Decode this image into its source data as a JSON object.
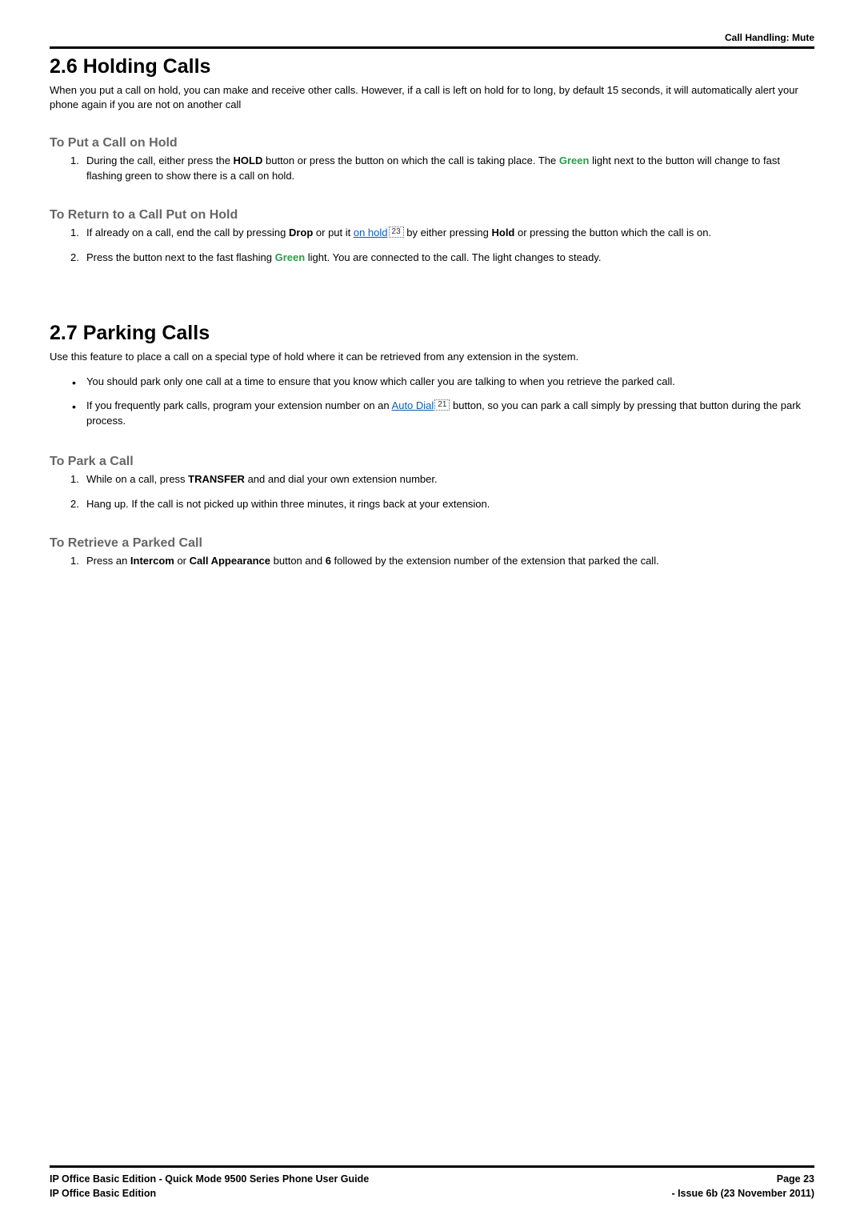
{
  "header": {
    "breadcrumb": "Call Handling: Mute"
  },
  "section_26": {
    "title": "2.6 Holding Calls",
    "intro": "When you put a call on hold, you can make and receive other calls. However, if a call is left on hold for to long, by default 15 seconds, it will automatically alert your phone again if you are not on another call",
    "put_on_hold": {
      "heading": "To Put a Call on Hold",
      "item1_prefix": "During the call, either press the ",
      "item1_hold": "HOLD",
      "item1_mid": " button or press the button on which the call is taking place. The ",
      "item1_green": "Green",
      "item1_suffix": " light next to the button will change to fast flashing green to show there is a call on hold."
    },
    "return_hold": {
      "heading": "To Return to a Call Put on Hold",
      "item1_prefix": "If already on a call, end the call by pressing ",
      "item1_drop": "Drop",
      "item1_mid1": " or put it ",
      "item1_link": "on hold",
      "item1_ref": "23",
      "item1_mid2": " by either pressing ",
      "item1_hold": "Hold",
      "item1_suffix": " or pressing the button which the call is on.",
      "item2_prefix": "Press the button next to the fast flashing ",
      "item2_green": "Green",
      "item2_suffix": " light. You are connected to the call. The light changes to steady."
    }
  },
  "section_27": {
    "title": "2.7 Parking Calls",
    "intro": "Use this feature to place a call on a special type of hold where it can be retrieved from any extension in the system.",
    "bullet1": "You should park only one call at a time to ensure that you know which caller you are talking to when you retrieve the parked call.",
    "bullet2_prefix": "If you frequently park calls, program your extension number on an ",
    "bullet2_link": "Auto Dial",
    "bullet2_ref": "21",
    "bullet2_suffix": " button, so you can park a call simply by pressing that button during the park process.",
    "park_call": {
      "heading": "To Park a Call",
      "item1_prefix": "While on a call, press ",
      "item1_transfer": "TRANSFER",
      "item1_suffix": " and and dial your own extension number.",
      "item2": "Hang up. If the call is not picked up within three minutes, it rings back at your extension."
    },
    "retrieve": {
      "heading": "To Retrieve a Parked Call",
      "item1_prefix": "Press an ",
      "item1_intercom": "Intercom",
      "item1_or": " or ",
      "item1_ca": "Call Appearance",
      "item1_mid": " button and ",
      "item1_six": "6",
      "item1_suffix": " followed by the extension number of the extension that parked the call."
    }
  },
  "footer": {
    "left1": "IP Office Basic Edition - Quick Mode 9500 Series Phone User Guide",
    "left2": "IP Office Basic Edition",
    "right1": "Page 23",
    "right2": "- Issue 6b (23 November 2011)"
  }
}
